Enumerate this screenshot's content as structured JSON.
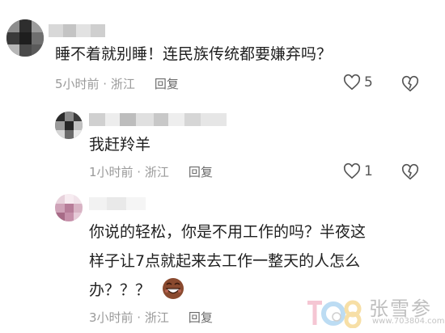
{
  "comments": [
    {
      "text": "睡不着就别睡！连民族传统都要嫌弃吗？",
      "time_location": "5小时前 · 浙江",
      "reply_label": "回复",
      "likes": "5"
    },
    {
      "text": "我赶羚羊",
      "time_location": "1小时前 · 浙江",
      "reply_label": "回复",
      "likes": "1"
    },
    {
      "text_lines": [
        "你说的轻松，你是不用工作的吗？半夜这",
        "样子让7点就起来去工作一整天的人怎么",
        "办？？？"
      ],
      "time_location": "3小时前 · 浙江",
      "reply_label": "回复"
    }
  ],
  "watermark": {
    "title": "张雪参",
    "url": "www.703804.com"
  },
  "icons": {
    "like": "heart-icon",
    "dislike": "broken-heart-icon",
    "emoji": "grinning-face-emoji"
  },
  "colors": {
    "text": "#1f1f1f",
    "meta": "#9a9a9a",
    "reply": "#6b6b6b",
    "icon": "#555555"
  }
}
